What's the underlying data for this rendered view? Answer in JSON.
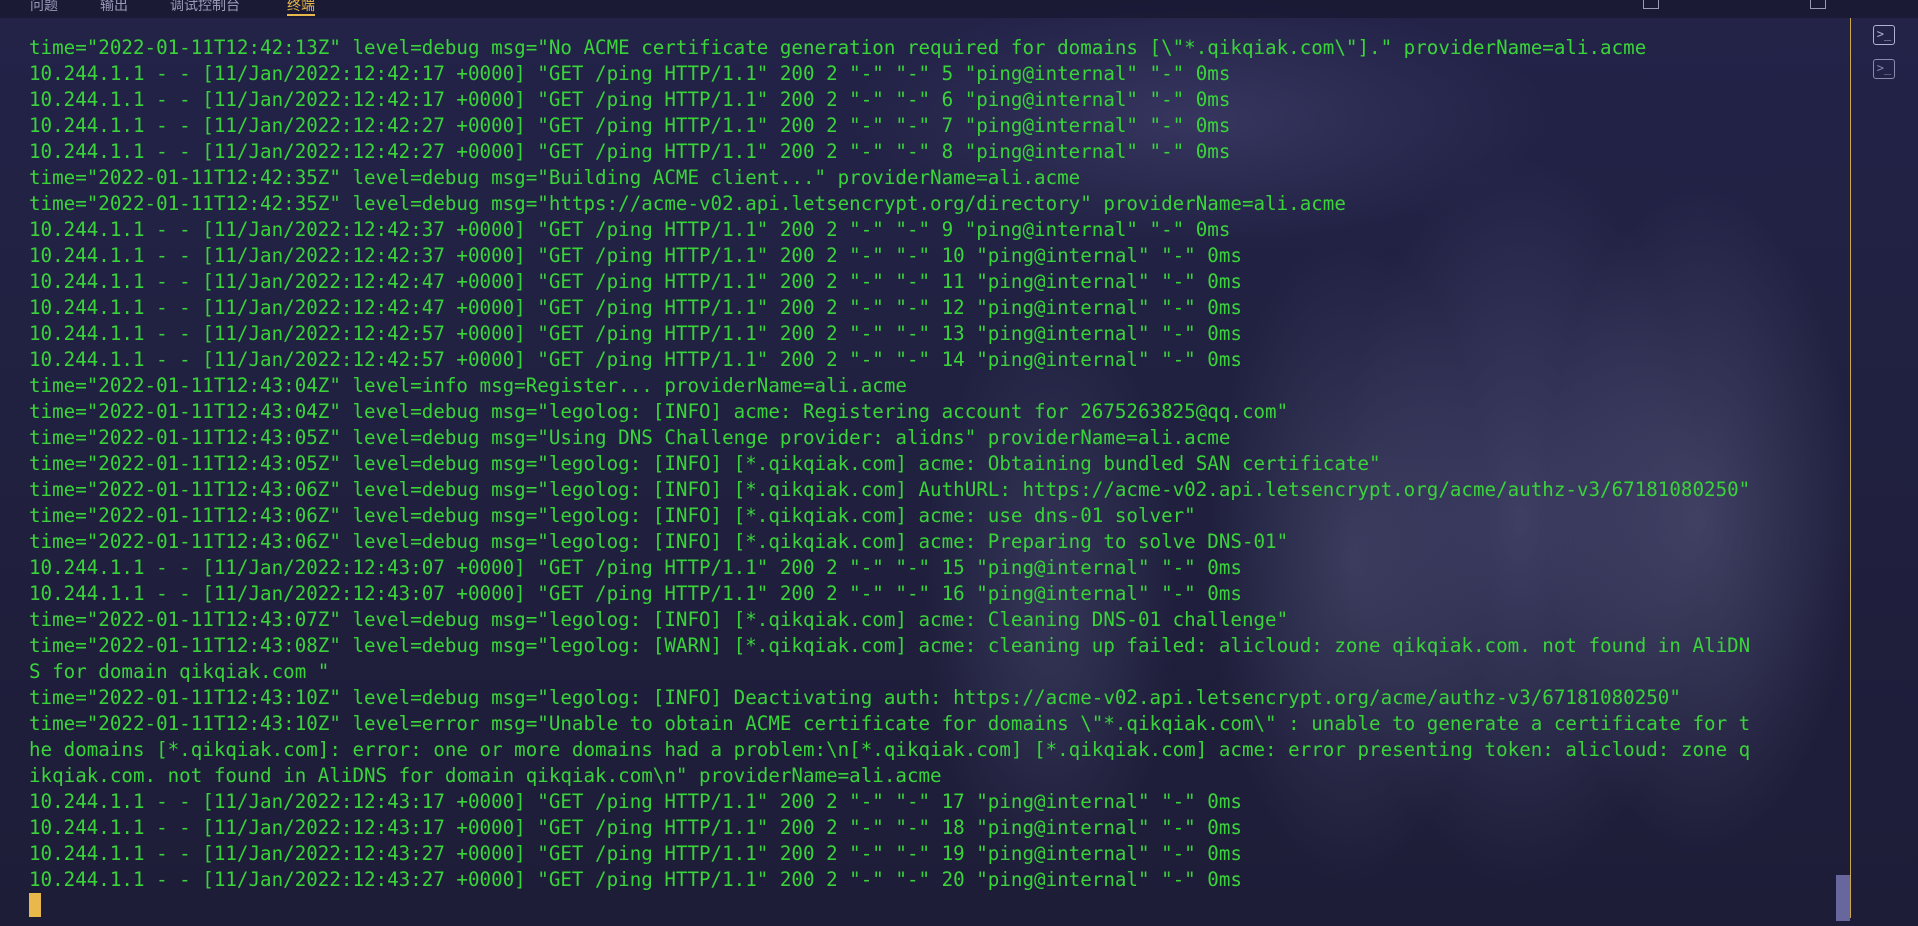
{
  "tabs": [
    "问题",
    "输出",
    "调试控制台",
    "终端"
  ],
  "active_tab": 3,
  "side_panel": {
    "items": [
      {
        "icon": "terminal-icon",
        "active": true
      },
      {
        "icon": "terminal-icon",
        "active": false
      }
    ]
  },
  "colors": {
    "text": "#3ad43a",
    "accent": "#e8b84a",
    "background": "#1e1e3a"
  },
  "terminal": {
    "lines": [
      "time=\"2022-01-11T12:42:13Z\" level=debug msg=\"No ACME certificate generation required for domains [\\\"*.qikqiak.com\\\"].\" providerName=ali.acme",
      "10.244.1.1 - - [11/Jan/2022:12:42:17 +0000] \"GET /ping HTTP/1.1\" 200 2 \"-\" \"-\" 5 \"ping@internal\" \"-\" 0ms",
      "10.244.1.1 - - [11/Jan/2022:12:42:17 +0000] \"GET /ping HTTP/1.1\" 200 2 \"-\" \"-\" 6 \"ping@internal\" \"-\" 0ms",
      "10.244.1.1 - - [11/Jan/2022:12:42:27 +0000] \"GET /ping HTTP/1.1\" 200 2 \"-\" \"-\" 7 \"ping@internal\" \"-\" 0ms",
      "10.244.1.1 - - [11/Jan/2022:12:42:27 +0000] \"GET /ping HTTP/1.1\" 200 2 \"-\" \"-\" 8 \"ping@internal\" \"-\" 0ms",
      "time=\"2022-01-11T12:42:35Z\" level=debug msg=\"Building ACME client...\" providerName=ali.acme",
      "time=\"2022-01-11T12:42:35Z\" level=debug msg=\"https://acme-v02.api.letsencrypt.org/directory\" providerName=ali.acme",
      "10.244.1.1 - - [11/Jan/2022:12:42:37 +0000] \"GET /ping HTTP/1.1\" 200 2 \"-\" \"-\" 9 \"ping@internal\" \"-\" 0ms",
      "10.244.1.1 - - [11/Jan/2022:12:42:37 +0000] \"GET /ping HTTP/1.1\" 200 2 \"-\" \"-\" 10 \"ping@internal\" \"-\" 0ms",
      "10.244.1.1 - - [11/Jan/2022:12:42:47 +0000] \"GET /ping HTTP/1.1\" 200 2 \"-\" \"-\" 11 \"ping@internal\" \"-\" 0ms",
      "10.244.1.1 - - [11/Jan/2022:12:42:47 +0000] \"GET /ping HTTP/1.1\" 200 2 \"-\" \"-\" 12 \"ping@internal\" \"-\" 0ms",
      "10.244.1.1 - - [11/Jan/2022:12:42:57 +0000] \"GET /ping HTTP/1.1\" 200 2 \"-\" \"-\" 13 \"ping@internal\" \"-\" 0ms",
      "10.244.1.1 - - [11/Jan/2022:12:42:57 +0000] \"GET /ping HTTP/1.1\" 200 2 \"-\" \"-\" 14 \"ping@internal\" \"-\" 0ms",
      "time=\"2022-01-11T12:43:04Z\" level=info msg=Register... providerName=ali.acme",
      "time=\"2022-01-11T12:43:04Z\" level=debug msg=\"legolog: [INFO] acme: Registering account for 2675263825@qq.com\"",
      "time=\"2022-01-11T12:43:05Z\" level=debug msg=\"Using DNS Challenge provider: alidns\" providerName=ali.acme",
      "time=\"2022-01-11T12:43:05Z\" level=debug msg=\"legolog: [INFO] [*.qikqiak.com] acme: Obtaining bundled SAN certificate\"",
      "time=\"2022-01-11T12:43:06Z\" level=debug msg=\"legolog: [INFO] [*.qikqiak.com] AuthURL: https://acme-v02.api.letsencrypt.org/acme/authz-v3/67181080250\"",
      "time=\"2022-01-11T12:43:06Z\" level=debug msg=\"legolog: [INFO] [*.qikqiak.com] acme: use dns-01 solver\"",
      "time=\"2022-01-11T12:43:06Z\" level=debug msg=\"legolog: [INFO] [*.qikqiak.com] acme: Preparing to solve DNS-01\"",
      "10.244.1.1 - - [11/Jan/2022:12:43:07 +0000] \"GET /ping HTTP/1.1\" 200 2 \"-\" \"-\" 15 \"ping@internal\" \"-\" 0ms",
      "10.244.1.1 - - [11/Jan/2022:12:43:07 +0000] \"GET /ping HTTP/1.1\" 200 2 \"-\" \"-\" 16 \"ping@internal\" \"-\" 0ms",
      "time=\"2022-01-11T12:43:07Z\" level=debug msg=\"legolog: [INFO] [*.qikqiak.com] acme: Cleaning DNS-01 challenge\"",
      "time=\"2022-01-11T12:43:08Z\" level=debug msg=\"legolog: [WARN] [*.qikqiak.com] acme: cleaning up failed: alicloud: zone qikqiak.com. not found in AliDN",
      "S for domain qikqiak.com \"",
      "time=\"2022-01-11T12:43:10Z\" level=debug msg=\"legolog: [INFO] Deactivating auth: https://acme-v02.api.letsencrypt.org/acme/authz-v3/67181080250\"",
      "time=\"2022-01-11T12:43:10Z\" level=error msg=\"Unable to obtain ACME certificate for domains \\\"*.qikqiak.com\\\" : unable to generate a certificate for t",
      "he domains [*.qikqiak.com]: error: one or more domains had a problem:\\n[*.qikqiak.com] [*.qikqiak.com] acme: error presenting token: alicloud: zone q",
      "ikqiak.com. not found in AliDNS for domain qikqiak.com\\n\" providerName=ali.acme",
      "10.244.1.1 - - [11/Jan/2022:12:43:17 +0000] \"GET /ping HTTP/1.1\" 200 2 \"-\" \"-\" 17 \"ping@internal\" \"-\" 0ms",
      "10.244.1.1 - - [11/Jan/2022:12:43:17 +0000] \"GET /ping HTTP/1.1\" 200 2 \"-\" \"-\" 18 \"ping@internal\" \"-\" 0ms",
      "10.244.1.1 - - [11/Jan/2022:12:43:27 +0000] \"GET /ping HTTP/1.1\" 200 2 \"-\" \"-\" 19 \"ping@internal\" \"-\" 0ms",
      "10.244.1.1 - - [11/Jan/2022:12:43:27 +0000] \"GET /ping HTTP/1.1\" 200 2 \"-\" \"-\" 20 \"ping@internal\" \"-\" 0ms"
    ]
  }
}
